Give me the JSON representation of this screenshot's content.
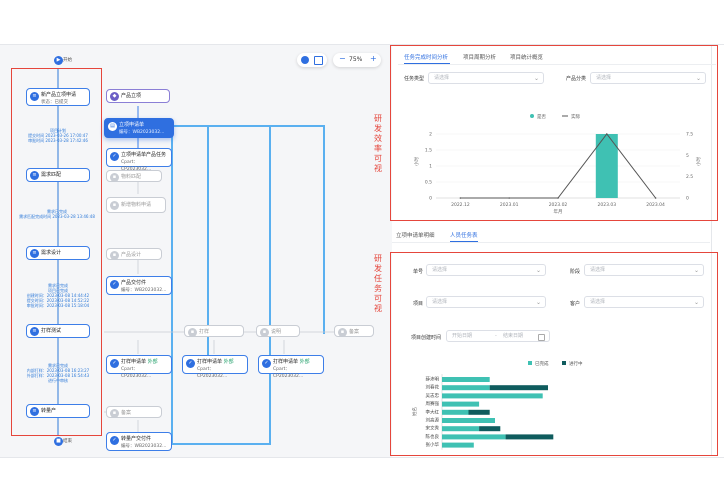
{
  "flow": {
    "start_label": "开始",
    "end_label": "结束",
    "zoom": {
      "level": "75%",
      "minus": "−",
      "plus": "+"
    },
    "main_nodes": [
      {
        "name": "新产品立项申请",
        "status": "状态：已提交"
      },
      {
        "name": "需求匹配"
      },
      {
        "name": "需求设计"
      },
      {
        "name": "打样测试"
      },
      {
        "name": "转量产"
      }
    ],
    "annotations": [
      [
        "项目计划",
        "提交时间 2023-03-26 17:00:47",
        "审批时间 2023-03-28 17:42:46"
      ],
      [
        "需求已完成",
        "需求匹配完成时间 2023-03-28 13:46:48"
      ],
      [
        "需求已完成",
        "项目已完成",
        "创建时间：2023-03-08 14:44:42",
        "提交时间：2023-03-08 14:52:22",
        "审批时间：2023-03-08 15:18:04"
      ],
      [
        "需求已完成",
        "内部打样：2023-03-08 16:23:27",
        "外部打样：2023-03-08 16:54:43",
        "进行中审核"
      ]
    ],
    "right_nodes": {
      "product_project": "产品立项",
      "project_apply": {
        "name": "立项申请单",
        "no": "编号：WB2023032..."
      },
      "product_task": {
        "name": "立项申请单产品任务",
        "no": "Cpart：CP2023032..."
      },
      "material_match": "物料匹配",
      "material_apply": "新增物料申请",
      "product_design": "产品设计",
      "product_deliver": {
        "name": "产品交付件",
        "no": "编号：WB2023032..."
      },
      "proof1": "打样",
      "proof_apply1": {
        "name": "打样申请单",
        "status": "外部",
        "no": "Cpart：CP2023032..."
      },
      "proof_apply2": {
        "name": "打样申请单",
        "status": "外部",
        "no": "Cpart：CP2023032..."
      },
      "proof_apply3": {
        "name": "打样申请单",
        "status": "外部",
        "no": "Cpart：CP2023032..."
      },
      "proof2": "说明",
      "proof3": "备案",
      "mass_note": "备案",
      "mass_deliver": {
        "name": "转量产交付件",
        "no": "编号：WB2023032..."
      }
    }
  },
  "side_labels": {
    "efficiency": [
      "研",
      "发",
      "效",
      "率",
      "可",
      "视"
    ],
    "task": [
      "研",
      "发",
      "任",
      "务",
      "可",
      "视"
    ]
  },
  "top_tabs": [
    {
      "label": "任务完成时间分析",
      "active": true
    },
    {
      "label": "项目周期分析",
      "active": false
    },
    {
      "label": "项目统计概览",
      "active": false
    }
  ],
  "top_filters": {
    "task_type": {
      "label": "任务类型",
      "placeholder": "请选择"
    },
    "product_category": {
      "label": "产品分类",
      "placeholder": "请选择"
    }
  },
  "bottom_tabs": [
    {
      "label": "立项申请单明细",
      "active": false
    },
    {
      "label": "人员任务表",
      "active": true
    }
  ],
  "bottom_filters": {
    "row1": [
      {
        "label": "单号",
        "placeholder": "请选择"
      },
      {
        "label": "阶段",
        "placeholder": "请选择"
      }
    ],
    "row2": [
      {
        "label": "项目",
        "placeholder": "请选择"
      },
      {
        "label": "客户",
        "placeholder": "请选择"
      }
    ],
    "date": {
      "label": "项目创建时间",
      "start": "开始日期",
      "end": "结束日期",
      "sep": "-"
    }
  },
  "colors": {
    "accent": "#2f6fe0",
    "teal": "#3fc1b3",
    "dark_teal": "#0f5c5e",
    "red": "#e5463c"
  },
  "chart_data": [
    {
      "type": "bar",
      "categories": [
        "2022.12",
        "2023.01",
        "2023.02",
        "2023.03",
        "2023.04"
      ],
      "series": [
        {
          "name": "是否",
          "type": "bar",
          "values": [
            0,
            0,
            0,
            2,
            0
          ]
        },
        {
          "name": "实际",
          "type": "line",
          "values": [
            0,
            0,
            0,
            7.5,
            0
          ]
        }
      ],
      "xlabel": "年月",
      "ylabel": "小时",
      "y2label": "小时",
      "yticks": [
        "0",
        "0.5",
        "1",
        "1.5",
        "2"
      ],
      "y2ticks": [
        "0",
        "2.5",
        "5",
        "7.5"
      ],
      "ylim": [
        0,
        2
      ],
      "y2lim": [
        0,
        7.5
      ],
      "legend_position": "top-center"
    },
    {
      "type": "bar",
      "orientation": "horizontal",
      "stacked": true,
      "categories": [
        "薛沛明",
        "刘春花",
        "吴志忠",
        "周赛强",
        "李大红",
        "刘高源",
        "宋文秀",
        "陈也良",
        "张小华"
      ],
      "series": [
        {
          "name": "已完成",
          "values": [
            9,
            9,
            19,
            7,
            5,
            10,
            7,
            12,
            6
          ]
        },
        {
          "name": "进行中",
          "values": [
            0,
            11,
            0,
            0,
            4,
            0,
            4,
            9,
            0
          ]
        }
      ],
      "ylabel": "姓名",
      "legend_position": "top-center"
    }
  ]
}
